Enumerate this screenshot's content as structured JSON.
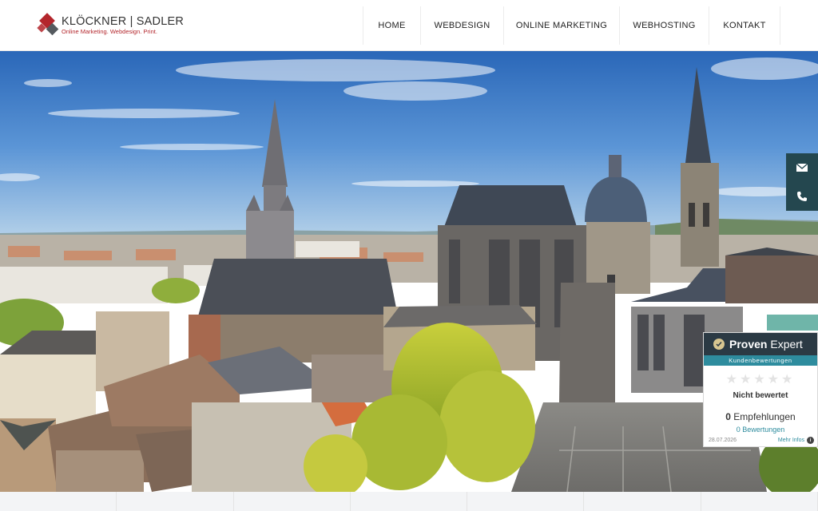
{
  "logo": {
    "title": "KLÖCKNER | SADLER",
    "tagline": "Online Marketing. Webdesign. Print."
  },
  "nav": [
    {
      "label": "HOME"
    },
    {
      "label": "WEBDESIGN"
    },
    {
      "label": "ONLINE MARKETING"
    },
    {
      "label": "WEBHOSTING"
    },
    {
      "label": "KONTAKT"
    }
  ],
  "contact_tab": {
    "icons": [
      "envelope-icon",
      "phone-icon"
    ],
    "color": "#24474f"
  },
  "proven_expert": {
    "brand_bold": "Proven",
    "brand_rest": " Expert",
    "subtitle": "Kundenbewertungen",
    "stars": "★★★★★",
    "rating": "Nicht bewertet",
    "recommendations_count": "0",
    "recommendations_label": " Empfehlungen",
    "reviews": "0 Bewertungen",
    "date": "28.07.2026",
    "more": "Mehr Infos",
    "info_glyph": "i"
  },
  "colors": {
    "brand_red": "#b3262c",
    "accent_teal": "#2e8c9e",
    "dark_teal": "#24474f"
  }
}
